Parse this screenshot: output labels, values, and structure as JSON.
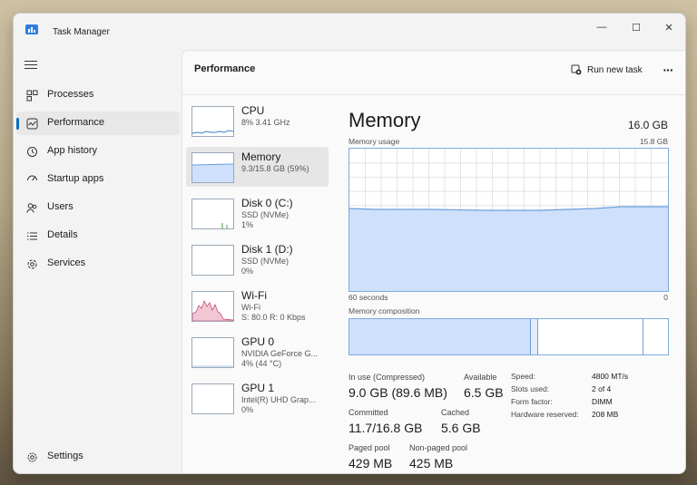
{
  "window": {
    "title": "Task Manager",
    "minimize": "—",
    "maximize": "☐",
    "close": "✕"
  },
  "sidebar": {
    "items": [
      {
        "label": "Processes",
        "icon": "processes-icon"
      },
      {
        "label": "Performance",
        "icon": "performance-icon",
        "active": true
      },
      {
        "label": "App history",
        "icon": "history-icon"
      },
      {
        "label": "Startup apps",
        "icon": "startup-icon"
      },
      {
        "label": "Users",
        "icon": "users-icon"
      },
      {
        "label": "Details",
        "icon": "details-icon"
      },
      {
        "label": "Services",
        "icon": "services-icon"
      }
    ],
    "settings": "Settings"
  },
  "header": {
    "title": "Performance",
    "run_new_task": "Run new task",
    "more": "···"
  },
  "resources": [
    {
      "name": "CPU",
      "line2": "8% 3.41 GHz",
      "line3": ""
    },
    {
      "name": "Memory",
      "line2": "9.3/15.8 GB (59%)",
      "line3": ""
    },
    {
      "name": "Disk 0 (C:)",
      "line2": "SSD (NVMe)",
      "line3": "1%"
    },
    {
      "name": "Disk 1 (D:)",
      "line2": "SSD (NVMe)",
      "line3": "0%"
    },
    {
      "name": "Wi-Fi",
      "line2": "Wi-Fi",
      "line3": "S: 80.0 R: 0 Kbps"
    },
    {
      "name": "GPU 0",
      "line2": "NVIDIA GeForce G...",
      "line3": "4% (44 °C)"
    },
    {
      "name": "GPU 1",
      "line2": "Intel(R) UHD Grap...",
      "line3": "0%"
    }
  ],
  "memory": {
    "title": "Memory",
    "total": "16.0 GB",
    "usage_label": "Memory usage",
    "usage_max": "15.8 GB",
    "time_left": "60 seconds",
    "time_right": "0",
    "composition_label": "Memory composition",
    "in_use_label": "In use (Compressed)",
    "in_use_value": "9.0 GB (89.6 MB)",
    "available_label": "Available",
    "available_value": "6.5 GB",
    "committed_label": "Committed",
    "committed_value": "11.7/16.8 GB",
    "cached_label": "Cached",
    "cached_value": "5.6 GB",
    "paged_label": "Paged pool",
    "paged_value": "429 MB",
    "nonpaged_label": "Non-paged pool",
    "nonpaged_value": "425 MB",
    "details": [
      {
        "key": "Speed:",
        "value": "4800 MT/s"
      },
      {
        "key": "Slots used:",
        "value": "2 of 4"
      },
      {
        "key": "Form factor:",
        "value": "DIMM"
      },
      {
        "key": "Hardware reserved:",
        "value": "208 MB"
      }
    ]
  },
  "colors": {
    "accent": "#0f6cbd",
    "memory_fill": "#cfe0fc",
    "memory_line": "#6b9fde",
    "wifi": "#c74a74"
  }
}
